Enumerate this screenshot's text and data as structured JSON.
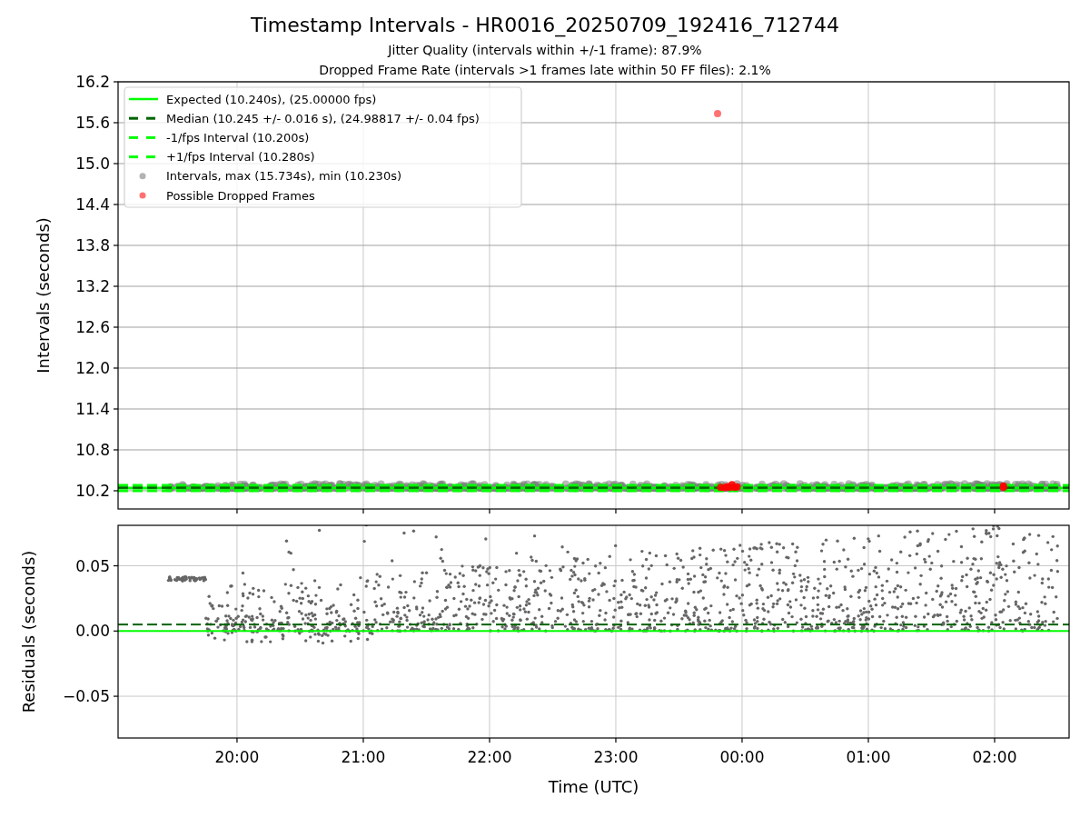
{
  "figure": {
    "title": "Timestamp Intervals - HR0016_20250709_192416_712744",
    "subtitles": [
      "Jitter Quality (intervals within +/-1 frame): 87.9%",
      "Dropped Frame Rate (intervals >1 frames late within 50 FF files): 2.1%"
    ]
  },
  "panels": [
    {
      "ylabel": "Intervals (seconds)",
      "yticks": [
        "16.2",
        "15.6",
        "15.0",
        "14.4",
        "13.8",
        "13.2",
        "12.6",
        "12.0",
        "11.4",
        "10.8",
        "10.2"
      ],
      "legend": [
        {
          "label": "Expected (10.240s), (25.00000 fps)",
          "color": "#00ff00",
          "kind": "line"
        },
        {
          "label": "Median (10.245 +/- 0.016 s), (24.98817 +/- 0.04 fps)",
          "color": "#006400",
          "kind": "dashed"
        },
        {
          "label": "-1/fps Interval (10.200s)",
          "color": "#00ff00",
          "kind": "dashed"
        },
        {
          "label": "+1/fps Interval (10.280s)",
          "color": "#00ff00",
          "kind": "dashed"
        },
        {
          "label": "Intervals, max (15.734s), min (10.230s)",
          "color": "#b3b3b3",
          "kind": "dot"
        },
        {
          "label": "Possible Dropped Frames",
          "color": "#ff7070",
          "kind": "dot"
        }
      ]
    },
    {
      "ylabel": "Residuals (seconds)",
      "yticks": [
        "0.05",
        "0.00",
        "−0.05"
      ],
      "xticks": [
        "20:00",
        "21:00",
        "22:00",
        "23:00",
        "00:00",
        "01:00",
        "02:00"
      ],
      "xlabel": "Time (UTC)"
    }
  ]
}
